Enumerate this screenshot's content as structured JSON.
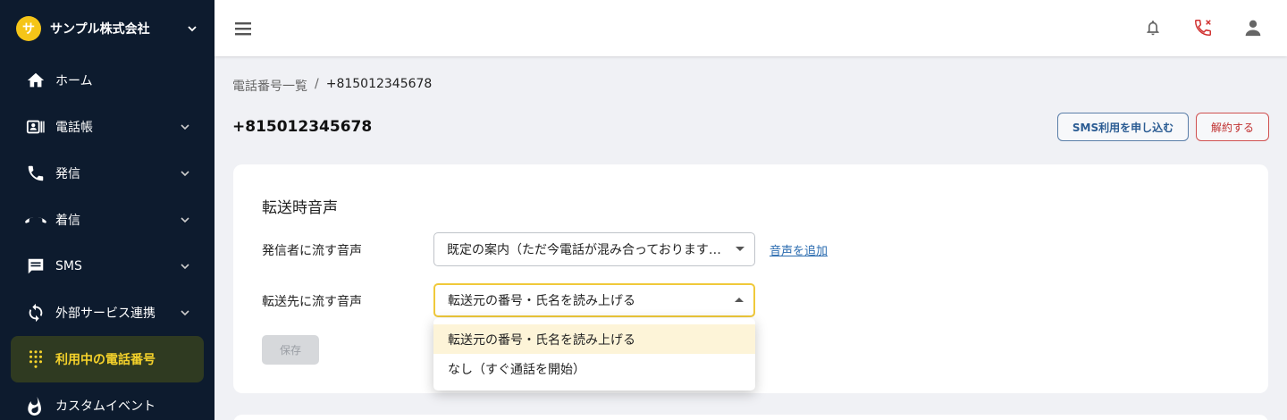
{
  "sidebar": {
    "org_logo": "サ",
    "org_name": "サンプル株式会社",
    "items": [
      {
        "label": "ホーム",
        "icon": "home-icon",
        "has_chevron": false
      },
      {
        "label": "電話帳",
        "icon": "contacts-icon",
        "has_chevron": true
      },
      {
        "label": "発信",
        "icon": "phone-icon",
        "has_chevron": true
      },
      {
        "label": "着信",
        "icon": "incoming-call-icon",
        "has_chevron": true
      },
      {
        "label": "SMS",
        "icon": "sms-icon",
        "has_chevron": true
      },
      {
        "label": "外部サービス連携",
        "icon": "sync-icon",
        "has_chevron": true
      },
      {
        "label": "利用中の電話番号",
        "icon": "dialpad-icon",
        "has_chevron": false,
        "active": true
      },
      {
        "label": "カスタムイベント",
        "icon": "fire-icon",
        "has_chevron": false
      }
    ]
  },
  "header": {
    "icons": [
      "menu-icon",
      "bell-icon",
      "phone-missed-icon",
      "user-icon"
    ]
  },
  "breadcrumb": {
    "parent": "電話番号一覧",
    "separator": "/",
    "current": "+815012345678"
  },
  "page": {
    "title": "+815012345678",
    "sms_button": "SMS利用を申し込む",
    "cancel_button": "解約する"
  },
  "transfer_voice": {
    "section_title": "転送時音声",
    "caller_label": "発信者に流す音声",
    "caller_value": "既定の案内（ただ今電話が混み合っておりますので、しばらくお待ちください）",
    "add_voice_link": "音声を追加",
    "dest_label": "転送先に流す音声",
    "dest_value": "転送元の番号・氏名を読み上げる",
    "save_button": "保存",
    "dropdown_options": [
      "転送元の番号・氏名を読み上げる",
      "なし（すぐ通話を開始）"
    ]
  },
  "colors": {
    "sidebar_bg": "#0d1b2e",
    "accent": "#f5d22b",
    "brand_logo": "#f5c518",
    "danger": "#c03030",
    "link": "#2b6cb0"
  }
}
